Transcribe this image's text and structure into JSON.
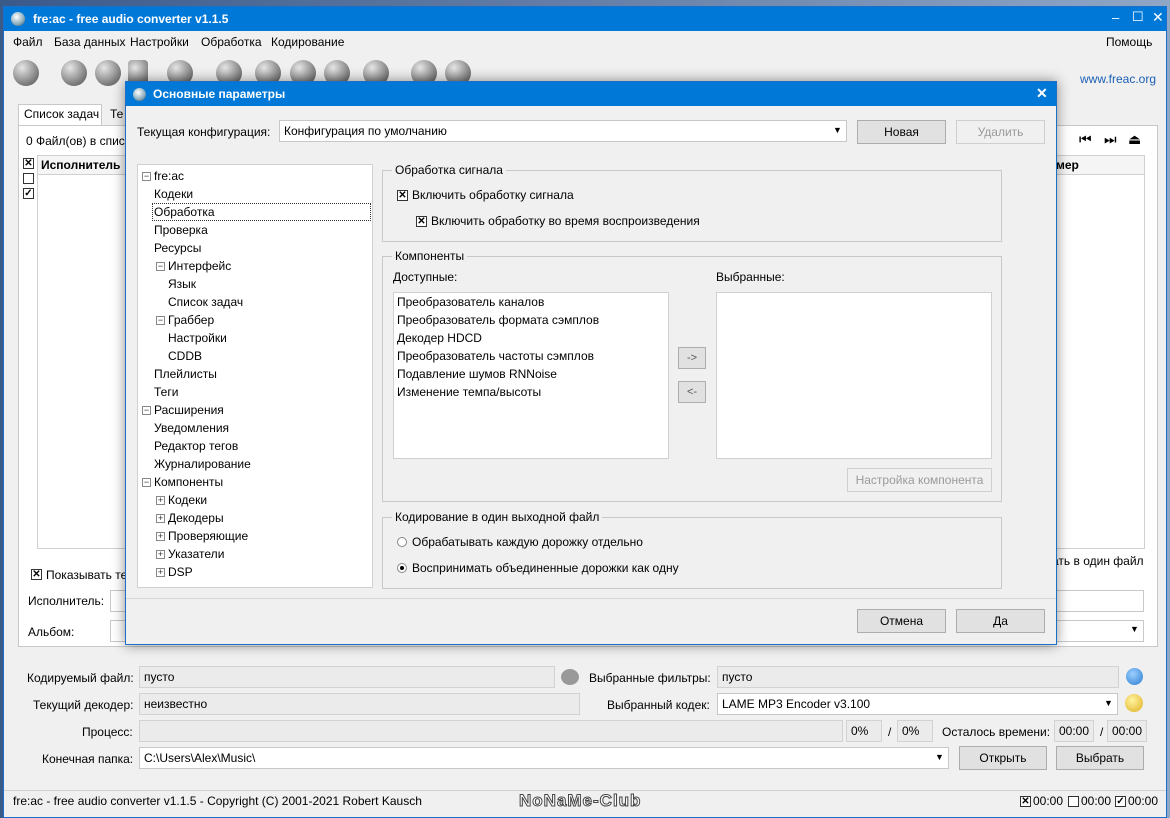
{
  "main_window": {
    "title": "fre:ac - free audio converter v1.1.5",
    "menu": [
      "Файл",
      "База данных",
      "Настройки",
      "Обработка",
      "Кодирование"
    ],
    "help": "Помощь",
    "website": "www.freac.org",
    "tabs": [
      "Список задач",
      "Те"
    ],
    "files_info": "0 Файл(ов) в списк",
    "col_artist": "Исполнитель",
    "col_right": "мер",
    "show_title": "Показывать те",
    "single_file_right": "ать в один файл",
    "artist_label": "Исполнитель:",
    "album_label": "Альбом:",
    "encoding_file_label": "Кодируемый файл:",
    "encoding_file_value": "пусто",
    "selected_filters_label": "Выбранные фильтры:",
    "selected_filters_value": "пусто",
    "current_decoder_label": "Текущий декодер:",
    "current_decoder_value": "неизвестно",
    "selected_codec_label": "Выбранный кодек:",
    "selected_codec_value": "LAME MP3 Encoder v3.100",
    "process_label": "Процесс:",
    "percent1": "0%",
    "slash": "/",
    "percent2": "0%",
    "time_left_label": "Осталось времени:",
    "time1": "00:00",
    "time2": "00:00",
    "output_folder_label": "Конечная папка:",
    "output_folder_value": "C:\\Users\\Alex\\Music\\",
    "open_button": "Открыть",
    "choose_button": "Выбрать",
    "status_text": "fre:ac - free audio converter v1.1.5 - Copyright (C) 2001-2021 Robert Kausch",
    "watermark": "NoNaMe-Club",
    "status_times": [
      "00:00",
      "00:00",
      "00:00"
    ]
  },
  "dialog": {
    "title": "Основные параметры",
    "config_label": "Текущая конфигурация:",
    "config_value": "Конфигурация по умолчанию",
    "new_button": "Новая",
    "delete_button": "Удалить",
    "tree": {
      "root": "fre:ac",
      "codecs": "Кодеки",
      "processing": "Обработка",
      "verification": "Проверка",
      "resources": "Ресурсы",
      "interface": "Интерфейс",
      "language": "Язык",
      "joblist": "Список задач",
      "ripper": "Граббер",
      "settings": "Настройки",
      "cddb": "CDDB",
      "playlists": "Плейлисты",
      "tags": "Теги",
      "extensions": "Расширения",
      "notifications": "Уведомления",
      "tag_editor": "Редактор тегов",
      "logging": "Журналирование",
      "components": "Компоненты",
      "c_codecs": "Кодеки",
      "c_decoders": "Декодеры",
      "c_verifiers": "Проверяющие",
      "c_indexers": "Указатели",
      "c_dsp": "DSP"
    },
    "signal_group": "Обработка сигнала",
    "enable_signal": "Включить обработку сигнала",
    "enable_playback": "Включить обработку во время воспроизведения",
    "components_group": "Компоненты",
    "available_label": "Доступные:",
    "selected_label": "Выбранные:",
    "available_items": [
      "Преобразователь каналов",
      "Преобразователь формата сэмплов",
      "Декодер HDCD",
      "Преобразователь частоты сэмплов",
      "Подавление шумов RNNoise",
      "Изменение темпа/высоты"
    ],
    "add_button": "->",
    "remove_button": "<-",
    "configure_button": "Настройка компонента",
    "single_file_group": "Кодирование в один выходной файл",
    "radio_each": "Обрабатывать каждую дорожку отдельно",
    "radio_joined": "Воспринимать объединенные дорожки как одну",
    "cancel_button": "Отмена",
    "ok_button": "Да"
  },
  "colors": {
    "titlebar": "#0078d7",
    "window_bg": "#f0f0f0",
    "selection_border": "#333333"
  }
}
